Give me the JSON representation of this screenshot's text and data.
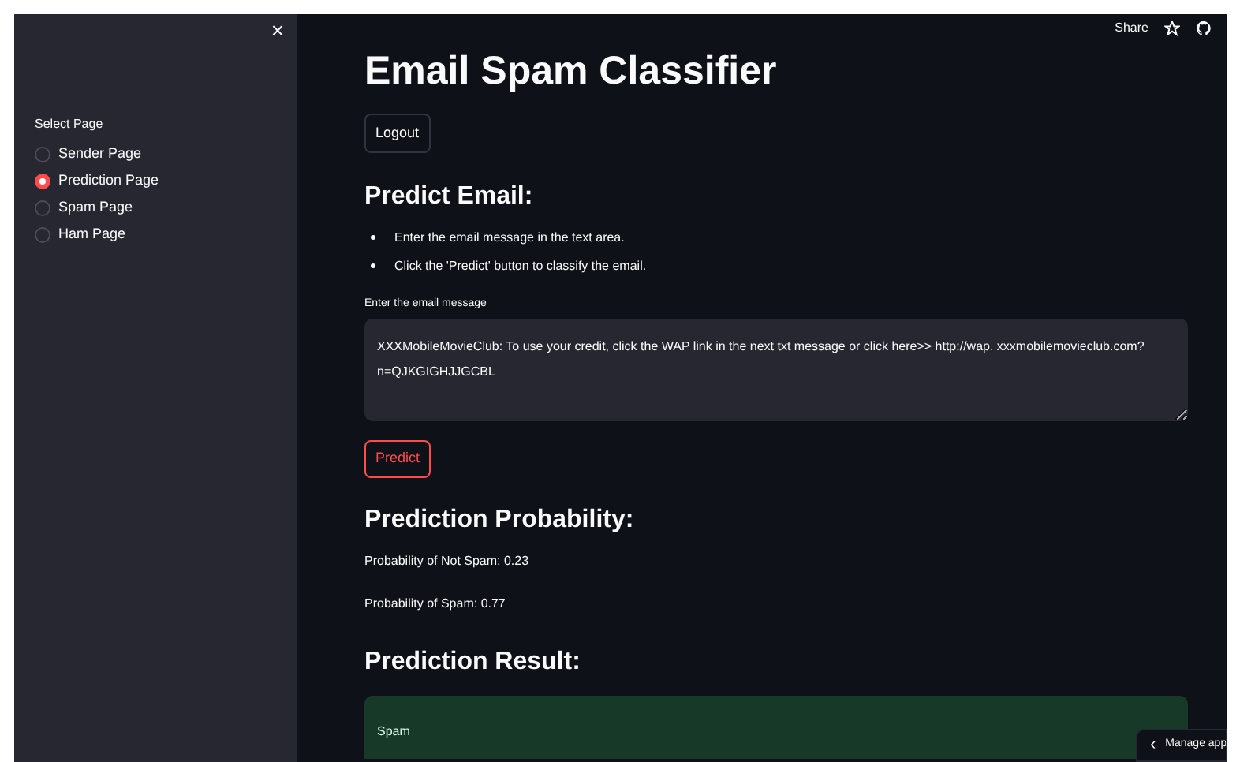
{
  "sidebar": {
    "close": "×",
    "label": "Select Page",
    "options": [
      {
        "label": "Sender Page",
        "selected": false
      },
      {
        "label": "Prediction Page",
        "selected": true
      },
      {
        "label": "Spam Page",
        "selected": false
      },
      {
        "label": "Ham Page",
        "selected": false
      }
    ]
  },
  "header": {
    "share": "Share"
  },
  "title": "Email Spam Classifier",
  "logout": "Logout",
  "predict_heading": "Predict Email:",
  "instructions": [
    "Enter the email message in the text area.",
    "Click the 'Predict' button to classify the email."
  ],
  "message_field": {
    "label": "Enter the email message",
    "value": "XXXMobileMovieClub: To use your credit, click the WAP link in the next txt message or click here>> http://wap. xxxmobilemovieclub.com?n=QJKGIGHJJGCBL"
  },
  "predict_button": "Predict",
  "probability_heading": "Prediction Probability:",
  "probabilities": [
    "Probability of Not Spam: 0.23",
    "Probability of Spam: 0.77"
  ],
  "result_heading": "Prediction Result:",
  "result": "Spam",
  "manage_app": {
    "icon": "‹",
    "label": "Manage app"
  }
}
